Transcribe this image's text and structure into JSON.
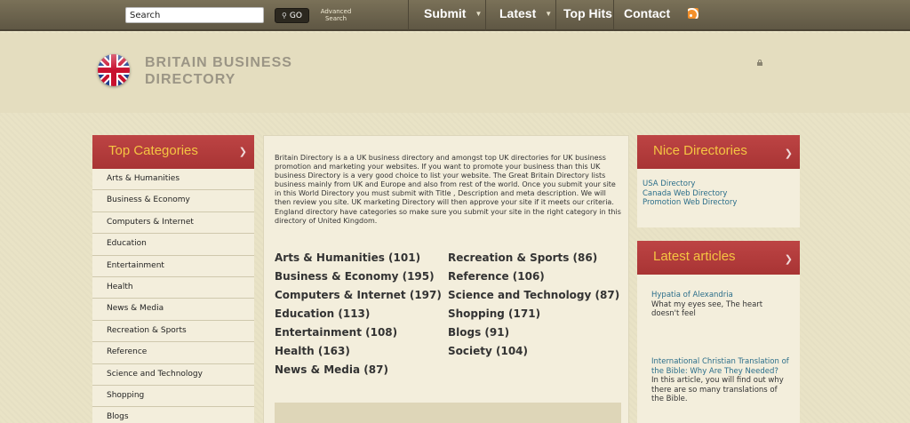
{
  "search": {
    "placeholder": "Search",
    "value": "Search",
    "go_label": "GO",
    "advanced_label": "Advanced Search"
  },
  "nav": {
    "items": [
      {
        "label": "Submit",
        "has_dropdown": true
      },
      {
        "label": "Latest",
        "has_dropdown": true
      },
      {
        "label": "Top Hits",
        "has_dropdown": false
      },
      {
        "label": "Contact",
        "has_dropdown": false
      }
    ],
    "rss_icon": "rss-icon"
  },
  "header": {
    "title_line1": "BRITAIN BUSINESS",
    "title_line2": "DIRECTORY",
    "logo_icon": "union-jack-flag-icon"
  },
  "colors": {
    "topbar": "#6b6350",
    "panel_red": "#b33c3c",
    "panel_title": "#f5c542",
    "link": "#2b6e8a",
    "background": "#e9e3c6"
  },
  "left_panel": {
    "title": "Top Categories",
    "items": [
      "Arts & Humanities",
      "Business & Economy",
      "Computers & Internet",
      "Education",
      "Entertainment",
      "Health",
      "News & Media",
      "Recreation & Sports",
      "Reference",
      "Science and Technology",
      "Shopping",
      "Blogs"
    ]
  },
  "main": {
    "intro": "Britain Directory is a a UK business directory and amongst top UK directories for UK business promotion and marketing your websites. If you want to promote your business than this UK business Directory is a very good choice to list your website. The Great Britain Directory lists business mainly from UK and Europe and also from rest of the world. Once you submit your site in this World Directory you must submit with Title , Description and meta description. We will then review you site. UK marketing Directory will then approve your site if it meets our criteria. England directory have categories so make sure you submit your site in the right category in this directory of United Kingdom.",
    "categories_left": [
      "Arts & Humanities (101)",
      "Business & Economy (195)",
      "Computers & Internet (197)",
      "Education (113)",
      "Entertainment (108)",
      "Health (163)",
      "News & Media (87)"
    ],
    "categories_right": [
      "Recreation & Sports (86)",
      "Reference (106)",
      "Science and Technology (87)",
      "Shopping (171)",
      "Blogs (91)",
      "Society (104)"
    ]
  },
  "right_panel": {
    "directories_title": "Nice Directories",
    "directories": [
      "USA Directory",
      "Canada Web Directory",
      "Promotion Web Directory"
    ],
    "articles_title": "Latest articles",
    "articles": [
      {
        "title": "Hypatia of Alexandria",
        "desc": "What my eyes see, The heart doesn't feel"
      },
      {
        "title": "International Christian Translation of the Bible: Why Are They Needed?",
        "desc": "In this article, you will find out why there are so many translations of the Bible."
      }
    ]
  }
}
